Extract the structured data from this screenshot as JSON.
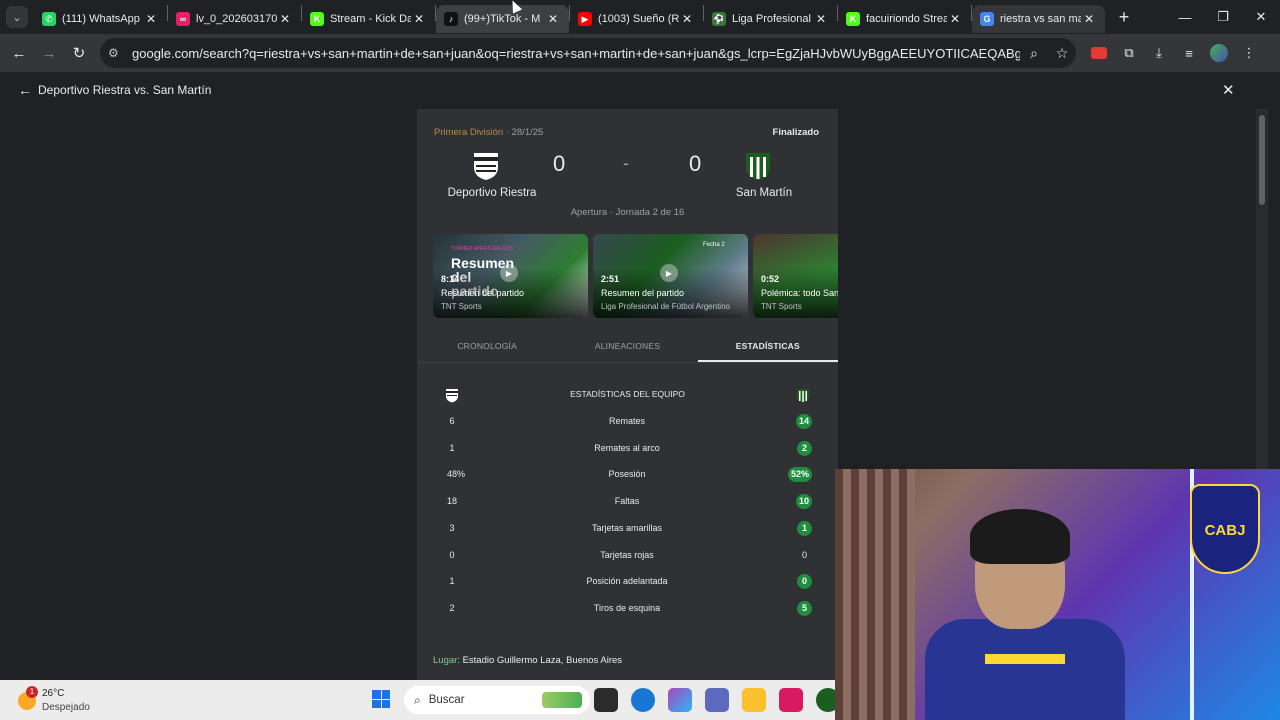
{
  "browser": {
    "tabs": [
      {
        "title": "(111) WhatsApp",
        "color": "#25d366",
        "glyph": "✆"
      },
      {
        "title": "lv_0_202603170",
        "color": "#e91e63",
        "glyph": "∞"
      },
      {
        "title": "Stream - Kick Da",
        "color": "#53fc18",
        "glyph": "K"
      },
      {
        "title": "(99+)TikTok - M",
        "color": "#111111",
        "glyph": "♪"
      },
      {
        "title": "(1003) Sueño (Re",
        "color": "#ff0000",
        "glyph": "▶"
      },
      {
        "title": "Liga Profesional",
        "color": "#2e7d32",
        "glyph": "⚽"
      },
      {
        "title": "facuiriondo Strea",
        "color": "#53fc18",
        "glyph": "K"
      },
      {
        "title": "riestra vs san ma",
        "color": "#4285f4",
        "glyph": "G"
      }
    ],
    "url": "google.com/search?q=riestra+vs+san+martin+de+san+juan&oq=riestra+vs+san+martin+de+san+juan&gs_lcrp=EgZjaHJvbWUyBggAEEUYOTIICAEQABgWGB4yCAgCE..."
  },
  "page": {
    "back_title": "Deportivo Riestra vs. San Martín"
  },
  "match": {
    "league": "Primera División",
    "date": "28/1/25",
    "status": "Finalizado",
    "home_team": "Deportivo Riestra",
    "away_team": "San Martín",
    "home_score": "0",
    "away_score": "0",
    "separator": "-",
    "round": "Apertura · Jornada 2 de 16",
    "venue_label": "Lugar:",
    "venue": "Estadio Guillermo Laza, Buenos Aires"
  },
  "videos": [
    {
      "duration": "8:14",
      "title": "Resumen del partido",
      "source": "TNT Sports",
      "overlay_big": "Resumen del partido",
      "overlay_small": "TORNEO APERTURA 2025"
    },
    {
      "duration": "2:51",
      "title": "Resumen del partido",
      "source": "Liga Profesional de Fútbol Argentino",
      "overlay_big": "",
      "overlay_small": "Fecha 2"
    },
    {
      "duration": "0:52",
      "title": "Polémica: todo San",
      "source": "TNT Sports",
      "overlay_big": "",
      "overlay_small": ""
    }
  ],
  "tabs": {
    "timeline": "CRONOLOGÍA",
    "lineups": "ALINEACIONES",
    "stats": "ESTADÍSTICAS"
  },
  "stats": {
    "title": "ESTADÍSTICAS DEL EQUIPO",
    "rows": [
      {
        "label": "Remates",
        "home": "6",
        "away": "14",
        "away_wins": true
      },
      {
        "label": "Remates al arco",
        "home": "1",
        "away": "2",
        "away_wins": true
      },
      {
        "label": "Posesión",
        "home": "48%",
        "away": "52%",
        "away_wins": true
      },
      {
        "label": "Faltas",
        "home": "18",
        "away": "10",
        "away_wins": true
      },
      {
        "label": "Tarjetas amarillas",
        "home": "3",
        "away": "1",
        "away_wins": true
      },
      {
        "label": "Tarjetas rojas",
        "home": "0",
        "away": "0",
        "away_wins": false
      },
      {
        "label": "Posición adelantada",
        "home": "1",
        "away": "0",
        "away_wins": true
      },
      {
        "label": "Tiros de esquina",
        "home": "2",
        "away": "5",
        "away_wins": true
      }
    ]
  },
  "taskbar": {
    "weather_temp": "26°C",
    "weather_desc": "Despejado",
    "weather_badge": "1",
    "search_placeholder": "Buscar"
  },
  "webcam": {
    "shirt_logo": "CABJ"
  }
}
